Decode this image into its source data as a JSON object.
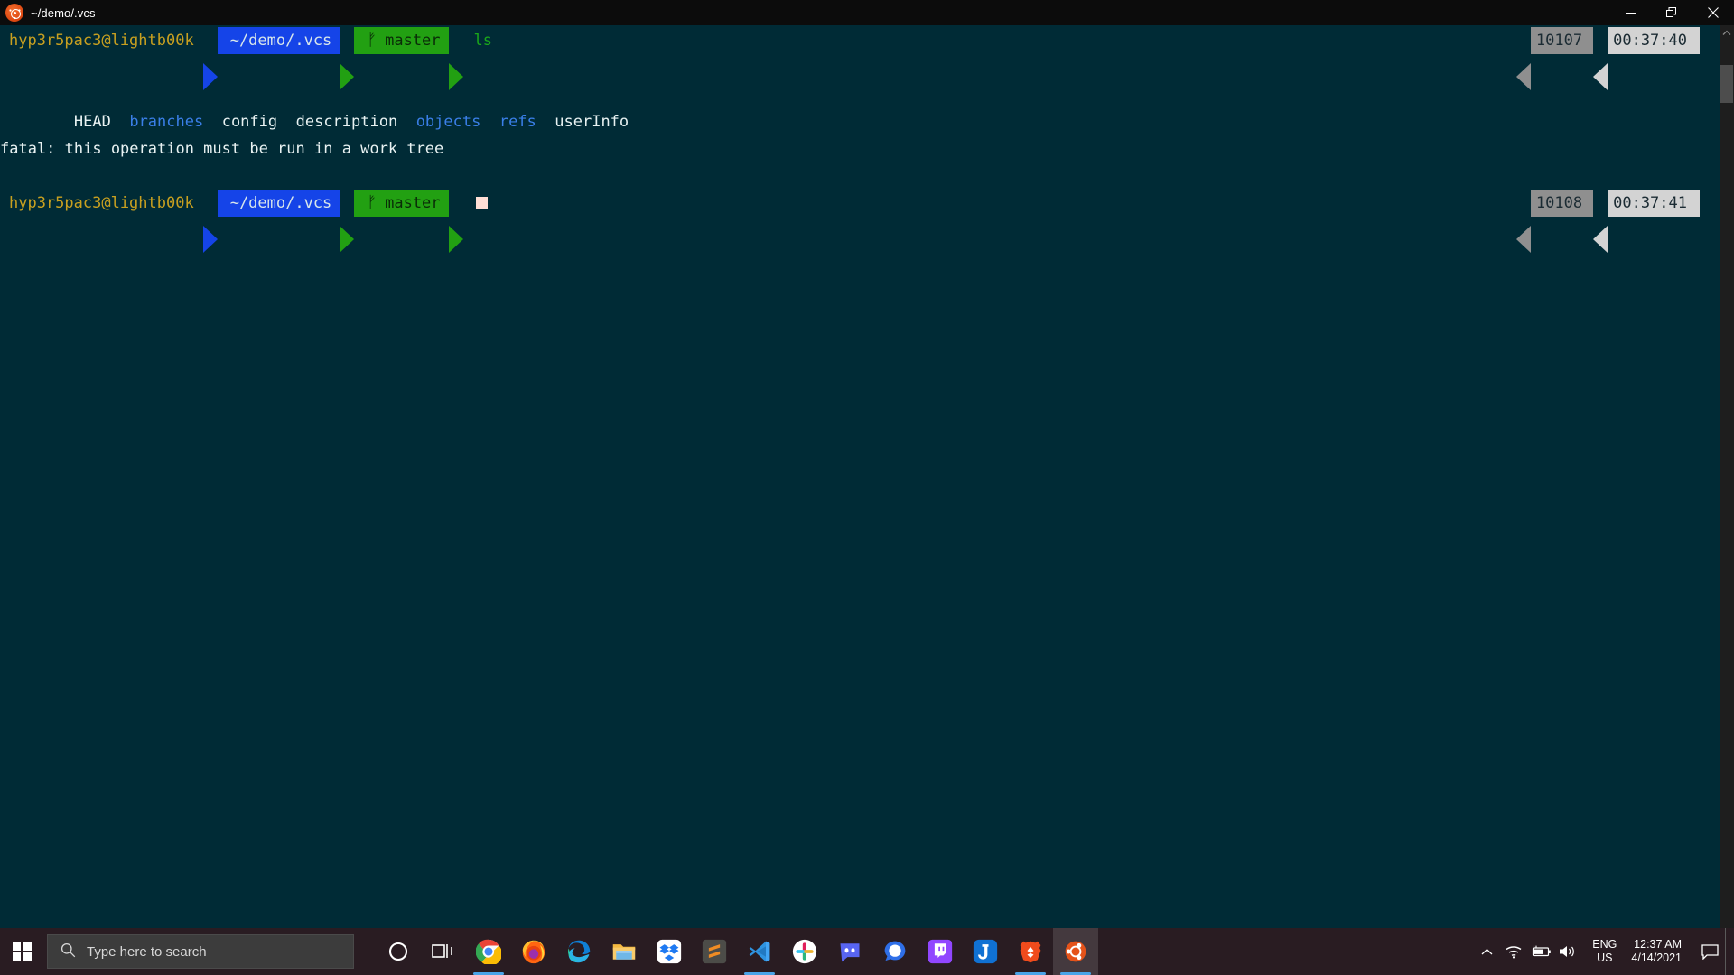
{
  "window": {
    "title": "~/demo/.vcs",
    "app_icon": "ubuntu-icon",
    "minimize_label": "Minimize",
    "maximize_label": "Restore",
    "close_label": "Close"
  },
  "terminal": {
    "background": "#002b36",
    "lines": [
      {
        "type": "prompt",
        "user": "hyp3r5pac3@lightb00k",
        "path": "~/demo/.vcs",
        "branch_glyph": "ᚠ",
        "branch": "master",
        "command": "ls",
        "count": "10107",
        "time": "00:37:40"
      },
      {
        "type": "output",
        "tokens": [
          {
            "text": "HEAD",
            "kind": "file"
          },
          {
            "text": "branches",
            "kind": "dir"
          },
          {
            "text": "config",
            "kind": "file"
          },
          {
            "text": "description",
            "kind": "file"
          },
          {
            "text": "objects",
            "kind": "dir"
          },
          {
            "text": "refs",
            "kind": "dir"
          },
          {
            "text": "userInfo",
            "kind": "file"
          }
        ]
      },
      {
        "type": "output",
        "text": "fatal: this operation must be run in a work tree"
      },
      {
        "type": "prompt",
        "user": "hyp3r5pac3@lightb00k",
        "path": "~/demo/.vcs",
        "branch_glyph": "ᚠ",
        "branch": "master",
        "command": "",
        "count": "10108",
        "time": "00:37:41"
      }
    ],
    "colors": {
      "user": "#c8a020",
      "path_bg": "#1544e8",
      "branch_bg": "#22a012",
      "command": "#1aa81a",
      "dir": "#3a7fe8",
      "file": "#e8f2f2",
      "count_bg": "#8f8f8f",
      "clock_bg": "#d3d3d3"
    }
  },
  "taskbar": {
    "start_label": "Start",
    "search": {
      "placeholder": "Type here to search",
      "icon": "search-icon"
    },
    "cortana_label": "Cortana",
    "taskview_label": "Task View",
    "apps": [
      {
        "name": "chrome",
        "label": "Google Chrome",
        "running": true
      },
      {
        "name": "firefox",
        "label": "Mozilla Firefox",
        "running": false
      },
      {
        "name": "edge",
        "label": "Microsoft Edge",
        "running": false
      },
      {
        "name": "explorer",
        "label": "File Explorer",
        "running": false
      },
      {
        "name": "dropbox",
        "label": "Dropbox",
        "running": false
      },
      {
        "name": "sublime",
        "label": "Sublime Text",
        "running": false
      },
      {
        "name": "vscode",
        "label": "Visual Studio Code",
        "running": true
      },
      {
        "name": "slack",
        "label": "Slack",
        "running": false
      },
      {
        "name": "discord",
        "label": "Discord",
        "running": false
      },
      {
        "name": "signal",
        "label": "Signal",
        "running": false
      },
      {
        "name": "twitch",
        "label": "Twitch",
        "running": false
      },
      {
        "name": "joplin",
        "label": "Joplin",
        "running": false
      },
      {
        "name": "brave",
        "label": "Brave",
        "running": true
      },
      {
        "name": "ubuntu",
        "label": "Ubuntu",
        "running": true,
        "active": true
      }
    ],
    "tray": {
      "overflow_label": "Show hidden icons",
      "wifi_label": "Network",
      "battery_label": "Battery charging",
      "volume_label": "Volume",
      "language_line1": "ENG",
      "language_line2": "US",
      "time": "12:37 AM",
      "date": "4/14/2021",
      "notifications_label": "Notifications"
    }
  }
}
